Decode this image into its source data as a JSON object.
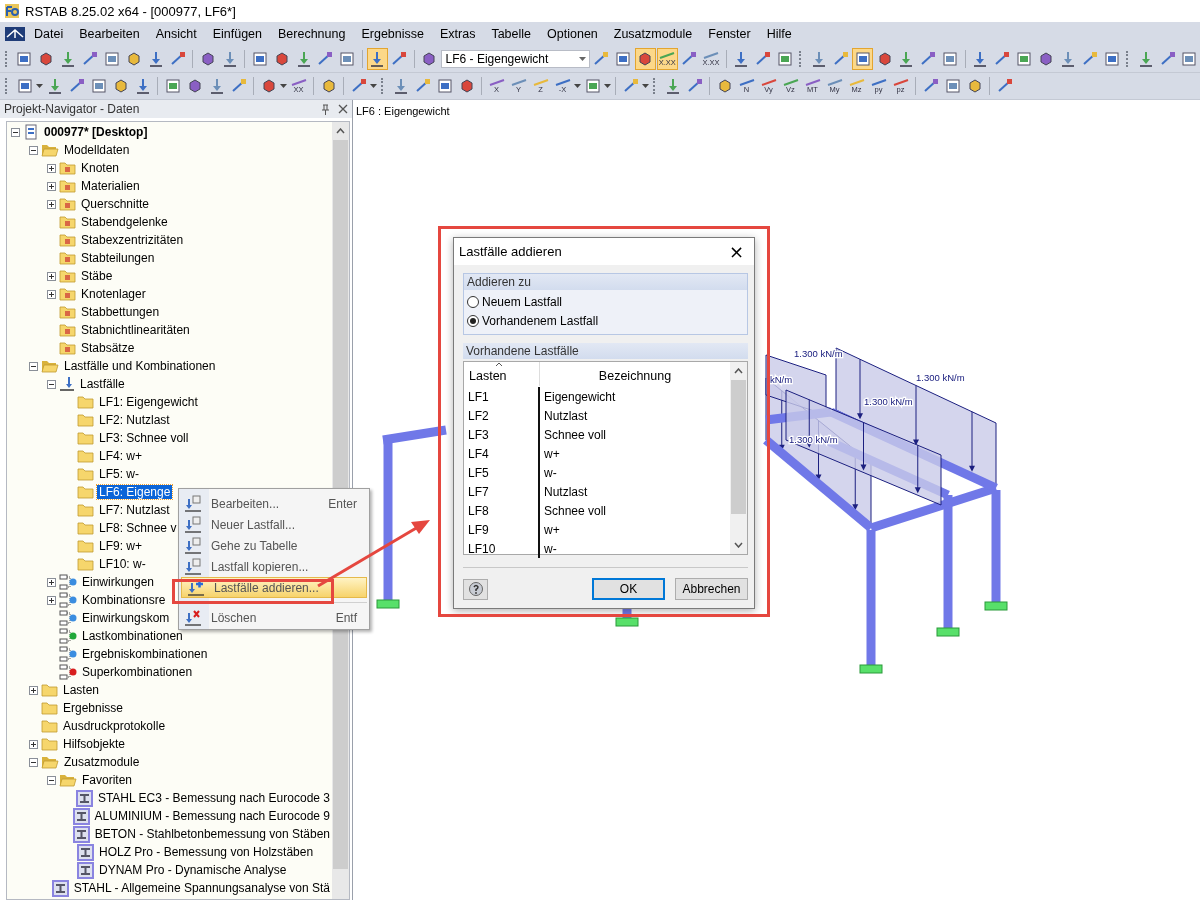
{
  "window": {
    "title": "RSTAB 8.25.02 x64 - [000977, LF6*]"
  },
  "menu": [
    "Datei",
    "Bearbeiten",
    "Ansicht",
    "Einfügen",
    "Berechnung",
    "Ergebnisse",
    "Extras",
    "Tabelle",
    "Optionen",
    "Zusatzmodule",
    "Fenster",
    "Hilfe"
  ],
  "toolbar_1": [
    {
      "kind": "grip"
    },
    {
      "kind": "button",
      "on": false
    },
    {
      "kind": "button",
      "on": false
    },
    {
      "kind": "button",
      "on": false
    },
    {
      "kind": "button",
      "on": false
    },
    {
      "kind": "button",
      "on": false
    },
    {
      "kind": "button",
      "on": false
    },
    {
      "kind": "button",
      "on": false
    },
    {
      "kind": "button",
      "on": false
    },
    {
      "kind": "sep"
    },
    {
      "kind": "button",
      "on": false
    },
    {
      "kind": "button",
      "on": false
    },
    {
      "kind": "sep"
    },
    {
      "kind": "button",
      "on": false
    },
    {
      "kind": "button",
      "on": false
    },
    {
      "kind": "button",
      "on": false
    },
    {
      "kind": "button",
      "on": false
    },
    {
      "kind": "button",
      "on": false
    },
    {
      "kind": "sep"
    },
    {
      "kind": "button",
      "on": true
    },
    {
      "kind": "button",
      "on": false
    },
    {
      "kind": "sep"
    },
    {
      "kind": "button",
      "on": false
    },
    {
      "kind": "dropdown",
      "value": "LF6 - Eigengewicht"
    },
    {
      "kind": "button",
      "on": false
    },
    {
      "kind": "button",
      "on": false
    },
    {
      "kind": "button",
      "on": true
    },
    {
      "kind": "button",
      "on": true,
      "label": "X.XX"
    },
    {
      "kind": "button",
      "on": false
    },
    {
      "kind": "button",
      "on": false,
      "label": "X.XX"
    },
    {
      "kind": "sep"
    },
    {
      "kind": "button",
      "on": false
    },
    {
      "kind": "button",
      "on": false
    },
    {
      "kind": "button",
      "on": false
    },
    {
      "kind": "grip"
    },
    {
      "kind": "button",
      "on": false
    },
    {
      "kind": "button",
      "on": false
    },
    {
      "kind": "button",
      "on": true
    },
    {
      "kind": "button",
      "on": false
    },
    {
      "kind": "button",
      "on": false
    },
    {
      "kind": "button",
      "on": false
    },
    {
      "kind": "button",
      "on": false
    },
    {
      "kind": "sep"
    },
    {
      "kind": "button",
      "on": false
    },
    {
      "kind": "button",
      "on": false
    },
    {
      "kind": "button",
      "on": false
    },
    {
      "kind": "button",
      "on": false
    },
    {
      "kind": "button",
      "on": false
    },
    {
      "kind": "button",
      "on": false
    },
    {
      "kind": "button",
      "on": false
    },
    {
      "kind": "grip"
    },
    {
      "kind": "button",
      "on": false
    },
    {
      "kind": "button",
      "on": false
    },
    {
      "kind": "button",
      "on": false
    }
  ],
  "toolbar_2": [
    {
      "kind": "grip"
    },
    {
      "kind": "button",
      "on": false
    },
    {
      "kind": "caret"
    },
    {
      "kind": "button",
      "on": false
    },
    {
      "kind": "button",
      "on": false
    },
    {
      "kind": "button",
      "on": false
    },
    {
      "kind": "button",
      "on": false
    },
    {
      "kind": "button",
      "on": false
    },
    {
      "kind": "sep"
    },
    {
      "kind": "button",
      "on": false
    },
    {
      "kind": "button",
      "on": false
    },
    {
      "kind": "button",
      "on": false
    },
    {
      "kind": "button",
      "on": false
    },
    {
      "kind": "sep"
    },
    {
      "kind": "button",
      "on": false
    },
    {
      "kind": "caret"
    },
    {
      "kind": "button",
      "on": false,
      "label": "XX"
    },
    {
      "kind": "sep"
    },
    {
      "kind": "button",
      "on": false
    },
    {
      "kind": "sep"
    },
    {
      "kind": "button",
      "on": false
    },
    {
      "kind": "caret"
    },
    {
      "kind": "grip"
    },
    {
      "kind": "button",
      "on": false
    },
    {
      "kind": "button",
      "on": false
    },
    {
      "kind": "button",
      "on": false
    },
    {
      "kind": "button",
      "on": false
    },
    {
      "kind": "sep"
    },
    {
      "kind": "button",
      "on": false,
      "label": "X"
    },
    {
      "kind": "button",
      "on": false,
      "label": "Y"
    },
    {
      "kind": "button",
      "on": false,
      "label": "Z"
    },
    {
      "kind": "button",
      "on": false,
      "label": "-X"
    },
    {
      "kind": "caret"
    },
    {
      "kind": "button",
      "on": false
    },
    {
      "kind": "caret"
    },
    {
      "kind": "sep"
    },
    {
      "kind": "button",
      "on": false
    },
    {
      "kind": "caret"
    },
    {
      "kind": "grip"
    },
    {
      "kind": "button",
      "on": false
    },
    {
      "kind": "button",
      "on": false
    },
    {
      "kind": "sep"
    },
    {
      "kind": "button",
      "on": false
    },
    {
      "kind": "button",
      "on": false,
      "label": "N"
    },
    {
      "kind": "button",
      "on": false,
      "label": "Vy"
    },
    {
      "kind": "button",
      "on": false,
      "label": "Vz"
    },
    {
      "kind": "button",
      "on": false,
      "label": "MT"
    },
    {
      "kind": "button",
      "on": false,
      "label": "My"
    },
    {
      "kind": "button",
      "on": false,
      "label": "Mz"
    },
    {
      "kind": "button",
      "on": false,
      "label": "py"
    },
    {
      "kind": "button",
      "on": false,
      "label": "pz"
    },
    {
      "kind": "sep"
    },
    {
      "kind": "button",
      "on": false
    },
    {
      "kind": "button",
      "on": false
    },
    {
      "kind": "button",
      "on": false
    },
    {
      "kind": "sep"
    },
    {
      "kind": "button",
      "on": false
    }
  ],
  "navigator": {
    "title": "Projekt-Navigator - Daten",
    "tree": [
      {
        "label": "000977* [Desktop]",
        "kind": "project",
        "expanded": true,
        "selected": false,
        "children": [
          {
            "label": "Modelldaten",
            "kind": "folder-open",
            "expanded": true,
            "selected": false,
            "children": [
              {
                "label": "Knoten",
                "kind": "folder-item",
                "expanded": false,
                "selected": false
              },
              {
                "label": "Materialien",
                "kind": "folder-item",
                "expanded": false,
                "selected": false
              },
              {
                "label": "Querschnitte",
                "kind": "folder-item",
                "expanded": false,
                "selected": false
              },
              {
                "label": "Stabendgelenke",
                "kind": "folder-item",
                "selected": false
              },
              {
                "label": "Stabexzentrizitäten",
                "kind": "folder-item",
                "selected": false
              },
              {
                "label": "Stabteilungen",
                "kind": "folder-item",
                "selected": false
              },
              {
                "label": "Stäbe",
                "kind": "folder-item",
                "expanded": false,
                "selected": false
              },
              {
                "label": "Knotenlager",
                "kind": "folder-item",
                "expanded": false,
                "selected": false
              },
              {
                "label": "Stabbettungen",
                "kind": "folder-item",
                "selected": false
              },
              {
                "label": "Stabnichtlinearitäten",
                "kind": "folder-item",
                "selected": false
              },
              {
                "label": "Stabsätze",
                "kind": "folder-item",
                "selected": false
              }
            ]
          },
          {
            "label": "Lastfälle und Kombinationen",
            "kind": "folder-open",
            "expanded": true,
            "selected": false,
            "children": [
              {
                "label": "Lastfälle",
                "kind": "loadcase",
                "expanded": true,
                "selected": false,
                "children": [
                  {
                    "label": "LF1: Eigengewicht",
                    "kind": "folder",
                    "selected": false
                  },
                  {
                    "label": "LF2: Nutzlast",
                    "kind": "folder",
                    "selected": false
                  },
                  {
                    "label": "LF3: Schnee voll",
                    "kind": "folder",
                    "selected": false
                  },
                  {
                    "label": "LF4: w+",
                    "kind": "folder",
                    "selected": false
                  },
                  {
                    "label": "LF5: w-",
                    "kind": "folder",
                    "selected": false
                  },
                  {
                    "label": "LF6: Eigenge",
                    "kind": "folder",
                    "selected": true
                  },
                  {
                    "label": "LF7: Nutzlast",
                    "kind": "folder",
                    "selected": false
                  },
                  {
                    "label": "LF8: Schnee v",
                    "kind": "folder",
                    "selected": false
                  },
                  {
                    "label": "LF9: w+",
                    "kind": "folder",
                    "selected": false
                  },
                  {
                    "label": "LF10: w-",
                    "kind": "folder",
                    "selected": false
                  }
                ]
              },
              {
                "label": "Einwirkungen",
                "kind": "combo",
                "color": "#3b8de0",
                "expanded": false,
                "selected": false
              },
              {
                "label": "Kombinationsre",
                "kind": "combo",
                "color": "#3b8de0",
                "expanded": false,
                "selected": false
              },
              {
                "label": "Einwirkungskom",
                "kind": "combo",
                "color": "#3b8de0",
                "selected": false
              },
              {
                "label": "Lastkombinationen",
                "kind": "combo",
                "color": "#22a83a",
                "selected": false
              },
              {
                "label": "Ergebniskombinationen",
                "kind": "combo",
                "color": "#3b8de0",
                "selected": false
              },
              {
                "label": "Superkombinationen",
                "kind": "combo",
                "color": "#d81e1e",
                "selected": false
              }
            ]
          },
          {
            "label": "Lasten",
            "kind": "folder",
            "expanded": false,
            "selected": false
          },
          {
            "label": "Ergebnisse",
            "kind": "folder",
            "selected": false
          },
          {
            "label": "Ausdruckprotokolle",
            "kind": "folder",
            "selected": false
          },
          {
            "label": "Hilfsobjekte",
            "kind": "folder",
            "expanded": false,
            "selected": false
          },
          {
            "label": "Zusatzmodule",
            "kind": "folder-open",
            "expanded": true,
            "selected": false,
            "children": [
              {
                "label": "Favoriten",
                "kind": "folder-open",
                "expanded": true,
                "selected": false,
                "children": [
                  {
                    "label": "STAHL EC3 - Bemessung nach Eurocode 3",
                    "kind": "module",
                    "selected": false
                  },
                  {
                    "label": "ALUMINIUM - Bemessung nach Eurocode 9",
                    "kind": "module",
                    "selected": false
                  },
                  {
                    "label": "BETON - Stahlbetonbemessung von Stäben",
                    "kind": "module",
                    "selected": false
                  },
                  {
                    "label": "HOLZ Pro - Bemessung von Holzstäben",
                    "kind": "module",
                    "selected": false
                  },
                  {
                    "label": "DYNAM Pro - Dynamische Analyse",
                    "kind": "module",
                    "selected": false
                  }
                ]
              },
              {
                "label": "STAHL - Allgemeine Spannungsanalyse von Stä",
                "kind": "module",
                "selected": false
              }
            ]
          }
        ]
      }
    ]
  },
  "context_menu": {
    "items": [
      {
        "kind": "item",
        "label": "Bearbeiten...",
        "shortcut": "Enter",
        "selected": false
      },
      {
        "kind": "item",
        "label": "Neuer Lastfall...",
        "selected": false
      },
      {
        "kind": "item",
        "label": "Gehe zu Tabelle",
        "selected": false
      },
      {
        "kind": "item",
        "label": "Lastfall kopieren...",
        "selected": false
      },
      {
        "kind": "item",
        "label": "Lastfälle addieren...",
        "selected": true
      },
      {
        "kind": "separator"
      },
      {
        "kind": "item",
        "label": "Löschen",
        "shortcut": "Entf",
        "selected": false
      }
    ]
  },
  "viewport": {
    "label": "LF6 : Eigengewicht",
    "load_labels": [
      "1.300 kN/m",
      "kN/m",
      "1.300 kN/m",
      "1.300 kN/m",
      "1.300 kN/m"
    ]
  },
  "dialog": {
    "title": "Lastfälle addieren",
    "close": "×",
    "group_1": {
      "title": "Addieren zu",
      "options": [
        {
          "label": "Neuem Lastfall",
          "selected": false
        },
        {
          "label": "Vorhandenem Lastfall",
          "selected": true
        }
      ]
    },
    "group_2": {
      "title": "Vorhandene Lastfälle",
      "columns": [
        "Lasten",
        "Bezeichnung"
      ],
      "rows": [
        [
          "LF1",
          "Eigengewicht"
        ],
        [
          "LF2",
          "Nutzlast"
        ],
        [
          "LF3",
          "Schnee voll"
        ],
        [
          "LF4",
          "w+"
        ],
        [
          "LF5",
          "w-"
        ],
        [
          "LF7",
          "Nutzlast"
        ],
        [
          "LF8",
          "Schnee voll"
        ],
        [
          "LF9",
          "w+"
        ],
        [
          "LF10",
          "w-"
        ]
      ]
    },
    "buttons": [
      "OK",
      "Abbrechen"
    ]
  }
}
